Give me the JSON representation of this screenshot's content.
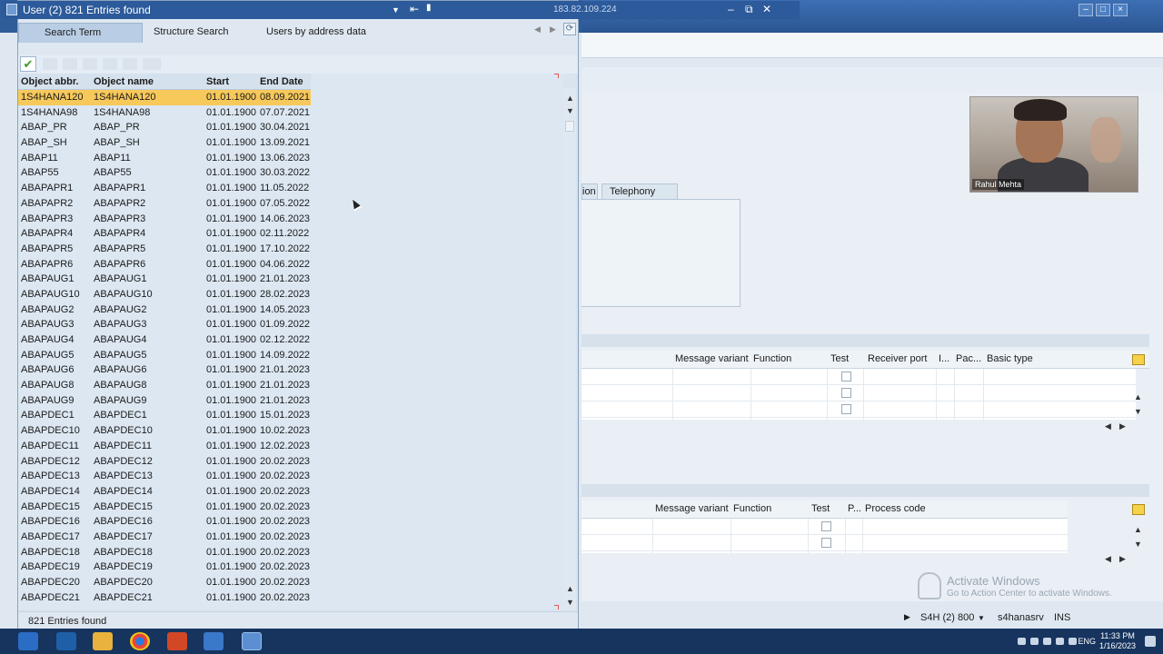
{
  "popup": {
    "title": "User (2)  821 Entries found",
    "host_ip": "183.82.109.224",
    "tabs": [
      {
        "label": "Search Term"
      },
      {
        "label": "Structure Search"
      },
      {
        "label": "Users by address data"
      }
    ],
    "columns": [
      "Object abbr.",
      "Object name",
      "Start",
      "End Date"
    ],
    "rows": [
      [
        "1S4HANA120",
        "1S4HANA120",
        "01.01.1900",
        "08.09.2021"
      ],
      [
        "1S4HANA98",
        "1S4HANA98",
        "01.01.1900",
        "07.07.2021"
      ],
      [
        "ABAP_PR",
        "ABAP_PR",
        "01.01.1900",
        "30.04.2021"
      ],
      [
        "ABAP_SH",
        "ABAP_SH",
        "01.01.1900",
        "13.09.2021"
      ],
      [
        "ABAP11",
        "ABAP11",
        "01.01.1900",
        "13.06.2023"
      ],
      [
        "ABAP55",
        "ABAP55",
        "01.01.1900",
        "30.03.2022"
      ],
      [
        "ABAPAPR1",
        "ABAPAPR1",
        "01.01.1900",
        "11.05.2022"
      ],
      [
        "ABAPAPR2",
        "ABAPAPR2",
        "01.01.1900",
        "07.05.2022"
      ],
      [
        "ABAPAPR3",
        "ABAPAPR3",
        "01.01.1900",
        "14.06.2023"
      ],
      [
        "ABAPAPR4",
        "ABAPAPR4",
        "01.01.1900",
        "02.11.2022"
      ],
      [
        "ABAPAPR5",
        "ABAPAPR5",
        "01.01.1900",
        "17.10.2022"
      ],
      [
        "ABAPAPR6",
        "ABAPAPR6",
        "01.01.1900",
        "04.06.2022"
      ],
      [
        "ABAPAUG1",
        "ABAPAUG1",
        "01.01.1900",
        "21.01.2023"
      ],
      [
        "ABAPAUG10",
        "ABAPAUG10",
        "01.01.1900",
        "28.02.2023"
      ],
      [
        "ABAPAUG2",
        "ABAPAUG2",
        "01.01.1900",
        "14.05.2023"
      ],
      [
        "ABAPAUG3",
        "ABAPAUG3",
        "01.01.1900",
        "01.09.2022"
      ],
      [
        "ABAPAUG4",
        "ABAPAUG4",
        "01.01.1900",
        "02.12.2022"
      ],
      [
        "ABAPAUG5",
        "ABAPAUG5",
        "01.01.1900",
        "14.09.2022"
      ],
      [
        "ABAPAUG6",
        "ABAPAUG6",
        "01.01.1900",
        "21.01.2023"
      ],
      [
        "ABAPAUG8",
        "ABAPAUG8",
        "01.01.1900",
        "21.01.2023"
      ],
      [
        "ABAPAUG9",
        "ABAPAUG9",
        "01.01.1900",
        "21.01.2023"
      ],
      [
        "ABAPDEC1",
        "ABAPDEC1",
        "01.01.1900",
        "15.01.2023"
      ],
      [
        "ABAPDEC10",
        "ABAPDEC10",
        "01.01.1900",
        "10.02.2023"
      ],
      [
        "ABAPDEC11",
        "ABAPDEC11",
        "01.01.1900",
        "12.02.2023"
      ],
      [
        "ABAPDEC12",
        "ABAPDEC12",
        "01.01.1900",
        "20.02.2023"
      ],
      [
        "ABAPDEC13",
        "ABAPDEC13",
        "01.01.1900",
        "20.02.2023"
      ],
      [
        "ABAPDEC14",
        "ABAPDEC14",
        "01.01.1900",
        "20.02.2023"
      ],
      [
        "ABAPDEC15",
        "ABAPDEC15",
        "01.01.1900",
        "20.02.2023"
      ],
      [
        "ABAPDEC16",
        "ABAPDEC16",
        "01.01.1900",
        "20.02.2023"
      ],
      [
        "ABAPDEC17",
        "ABAPDEC17",
        "01.01.1900",
        "20.02.2023"
      ],
      [
        "ABAPDEC18",
        "ABAPDEC18",
        "01.01.1900",
        "20.02.2023"
      ],
      [
        "ABAPDEC19",
        "ABAPDEC19",
        "01.01.1900",
        "20.02.2023"
      ],
      [
        "ABAPDEC20",
        "ABAPDEC20",
        "01.01.1900",
        "20.02.2023"
      ],
      [
        "ABAPDEC21",
        "ABAPDEC21",
        "01.01.1900",
        "20.02.2023"
      ]
    ],
    "selected_row": 0,
    "status_text": "821 Entries found"
  },
  "background": {
    "tabs": [
      {
        "label": "ion"
      },
      {
        "label": "Telephony"
      }
    ],
    "grid1_columns": [
      "Message variant",
      "Function",
      "Test",
      "Receiver port",
      "I...",
      "Pac...",
      "Basic type"
    ],
    "grid2_columns": [
      "Message variant",
      "Function",
      "Test",
      "P...",
      "Process code"
    ],
    "status_session": "S4H (2) 800",
    "status_server": "s4hanasrv",
    "status_mode": "INS"
  },
  "video": {
    "participant_name": "Rahul Mehta"
  },
  "watermark": {
    "line1": "Activate Windows",
    "line2": "Go to Action Center to activate Windows."
  },
  "taskbar": {
    "language": "ENG",
    "time": "11:33 PM",
    "date": "1/16/2023"
  },
  "icons": [
    "checkmark-icon",
    "refresh-icon",
    "table-settings-icon",
    "windows-start-icon",
    "powershell-icon",
    "file-explorer-icon",
    "chrome-icon",
    "powerpoint-icon",
    "sap-logon-icon",
    "sap-gui-icon"
  ]
}
